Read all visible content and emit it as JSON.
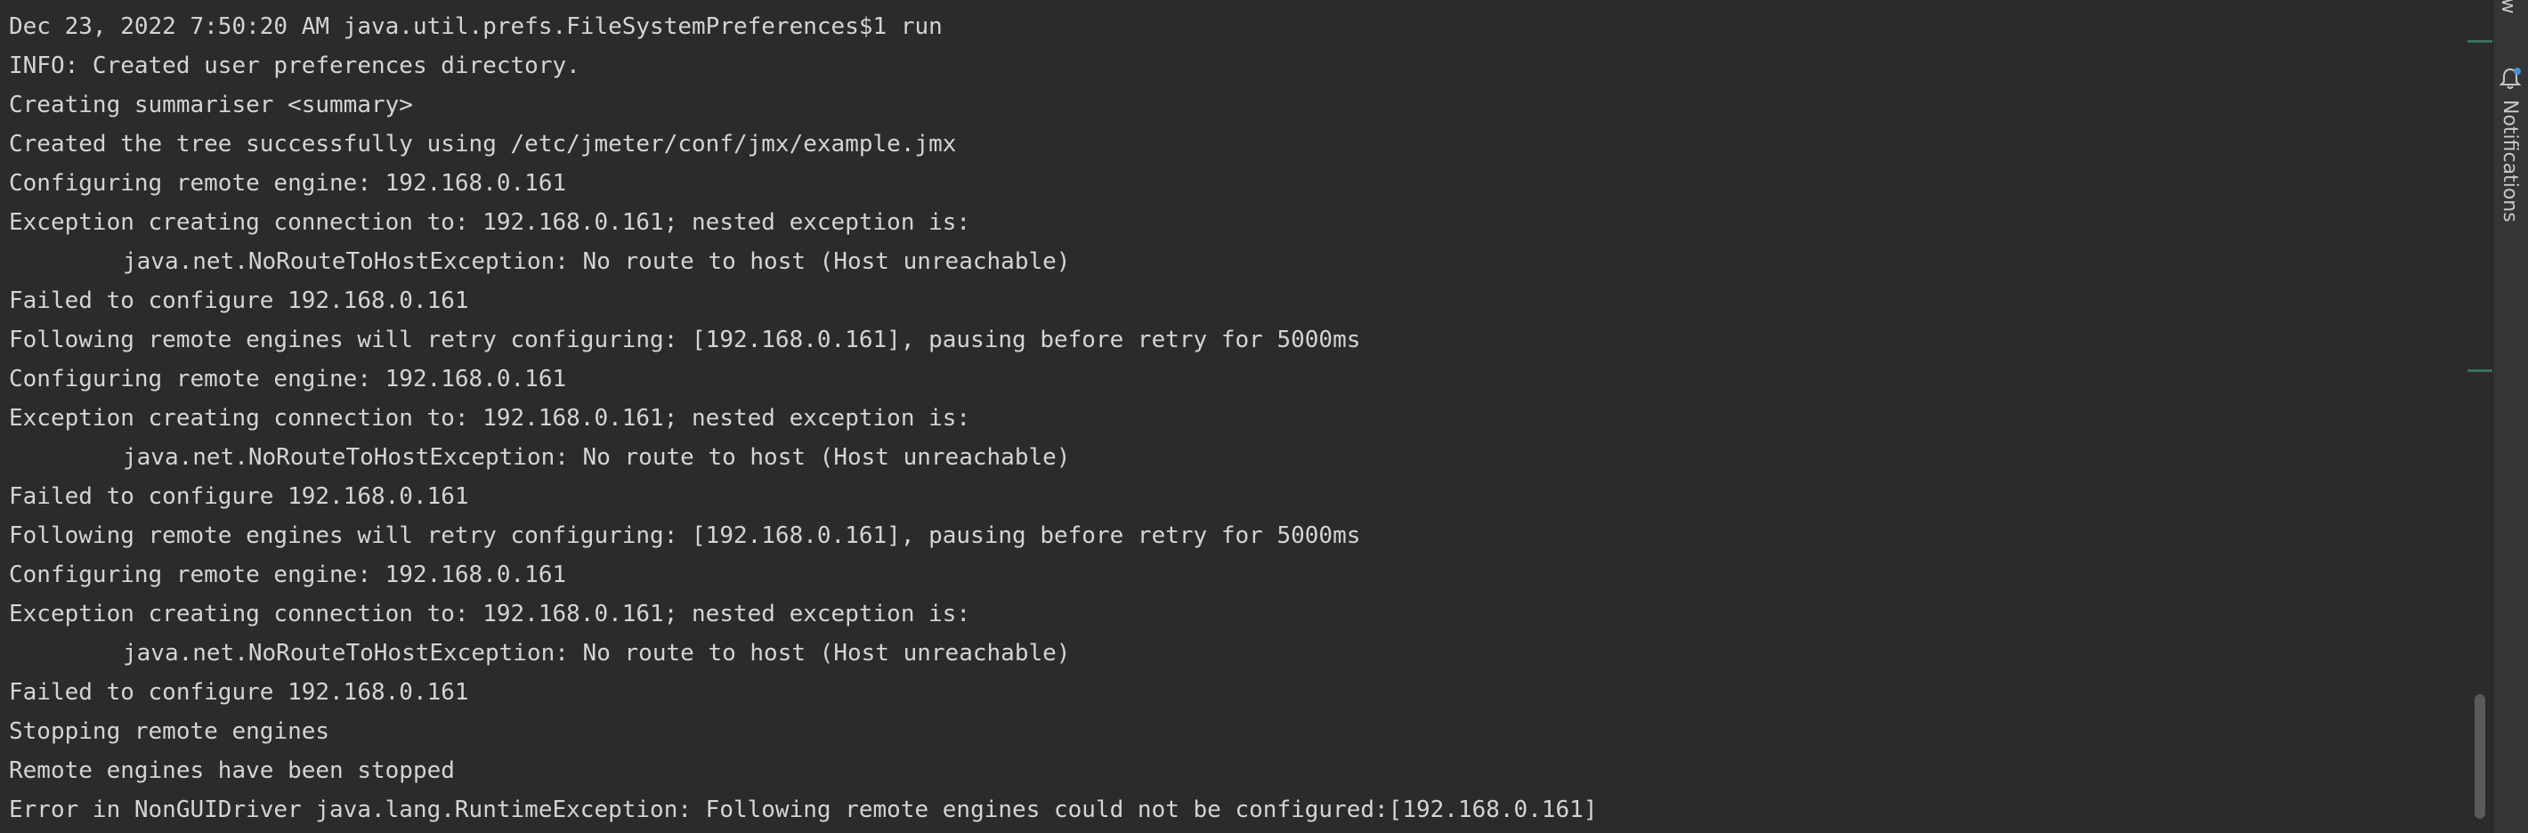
{
  "console": {
    "lines": [
      {
        "text": "Dec 23, 2022 7:50:20 AM java.util.prefs.FileSystemPreferences$1 run",
        "indent": false
      },
      {
        "text": "INFO: Created user preferences directory.",
        "indent": false
      },
      {
        "text": "Creating summariser <summary>",
        "indent": false
      },
      {
        "text": "Created the tree successfully using /etc/jmeter/conf/jmx/example.jmx",
        "indent": false
      },
      {
        "text": "Configuring remote engine: 192.168.0.161",
        "indent": false
      },
      {
        "text": "Exception creating connection to: 192.168.0.161; nested exception is:",
        "indent": false
      },
      {
        "text": "java.net.NoRouteToHostException: No route to host (Host unreachable)",
        "indent": true
      },
      {
        "text": "Failed to configure 192.168.0.161",
        "indent": false
      },
      {
        "text": "Following remote engines will retry configuring: [192.168.0.161], pausing before retry for 5000ms",
        "indent": false
      },
      {
        "text": "Configuring remote engine: 192.168.0.161",
        "indent": false
      },
      {
        "text": "Exception creating connection to: 192.168.0.161; nested exception is:",
        "indent": false
      },
      {
        "text": "java.net.NoRouteToHostException: No route to host (Host unreachable)",
        "indent": true
      },
      {
        "text": "Failed to configure 192.168.0.161",
        "indent": false
      },
      {
        "text": "Following remote engines will retry configuring: [192.168.0.161], pausing before retry for 5000ms",
        "indent": false
      },
      {
        "text": "Configuring remote engine: 192.168.0.161",
        "indent": false
      },
      {
        "text": "Exception creating connection to: 192.168.0.161; nested exception is:",
        "indent": false
      },
      {
        "text": "java.net.NoRouteToHostException: No route to host (Host unreachable)",
        "indent": true
      },
      {
        "text": "Failed to configure 192.168.0.161",
        "indent": false
      },
      {
        "text": "Stopping remote engines",
        "indent": false
      },
      {
        "text": "Remote engines have been stopped",
        "indent": false
      },
      {
        "text": "Error in NonGUIDriver java.lang.RuntimeException: Following remote engines could not be configured:[192.168.0.161]",
        "indent": false
      }
    ]
  },
  "right_strip": {
    "top_label": "ew",
    "notifications_label": "Notifications",
    "bell_icon": "bell-icon"
  },
  "colors": {
    "background": "#2b2b2b",
    "text": "#d4d4d4",
    "strip": "#333536",
    "marker": "#3d6e58",
    "badge": "#4a90d9"
  }
}
